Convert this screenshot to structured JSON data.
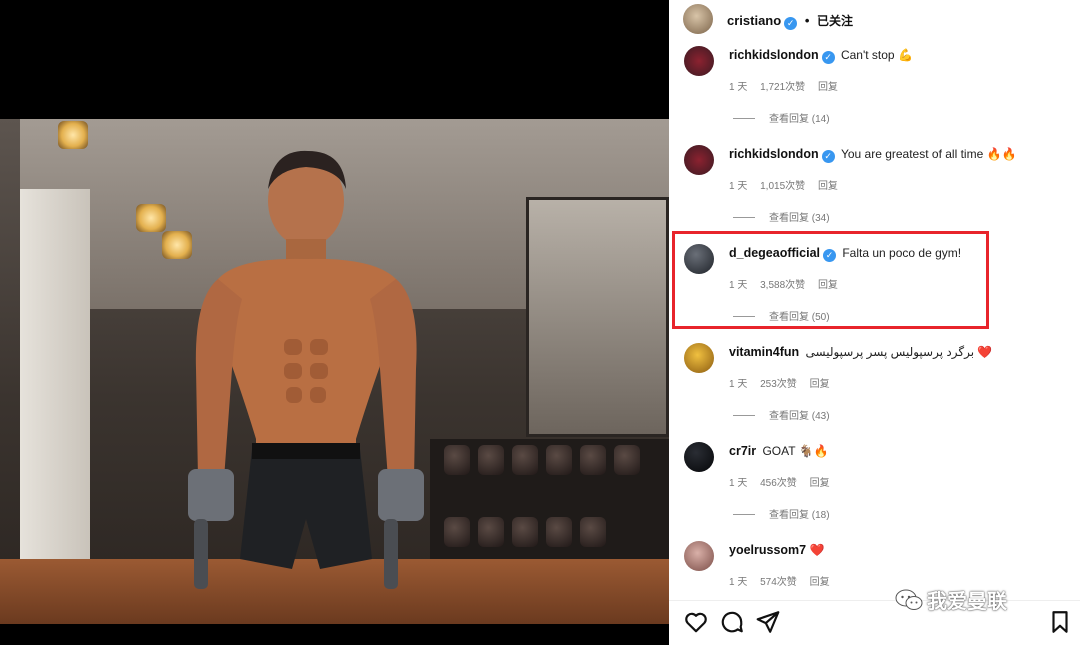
{
  "header": {
    "username": "cristiano",
    "separator": "•",
    "follow_label": "已关注"
  },
  "comments": [
    {
      "user": "richkidslondon",
      "verified": true,
      "text": "Can't stop",
      "emoji": "💪",
      "time": "1 天",
      "likes": "1,721次赞",
      "reply": "回复",
      "view_replies": "查看回复 (14)"
    },
    {
      "user": "richkidslondon",
      "verified": true,
      "text": "You are greatest of all time",
      "emoji": "🔥🔥",
      "time": "1 天",
      "likes": "1,015次赞",
      "reply": "回复",
      "view_replies": "查看回复 (34)"
    },
    {
      "user": "d_degeaofficial",
      "verified": true,
      "text": "Falta un poco de gym!",
      "emoji": "",
      "time": "1 天",
      "likes": "3,588次赞",
      "reply": "回复",
      "view_replies": "查看回复 (50)"
    },
    {
      "user": "vitamin4fun",
      "verified": false,
      "text": "برگرد پرسپولیس پسر پرسپولیسی",
      "emoji": "❤️",
      "time": "1 天",
      "likes": "253次赞",
      "reply": "回复",
      "view_replies": "查看回复 (43)"
    },
    {
      "user": "cr7ir",
      "verified": false,
      "text": "GOAT",
      "emoji": "🐐🔥",
      "time": "1 天",
      "likes": "456次赞",
      "reply": "回复",
      "view_replies": "查看回复 (18)"
    },
    {
      "user": "yoelrussom7",
      "verified": false,
      "text": "",
      "emoji": "❤️",
      "time": "1 天",
      "likes": "574次赞",
      "reply": "回复",
      "view_replies": ""
    }
  ],
  "watermark": "我爱曼联",
  "icons": {
    "like": "heart-icon",
    "comment": "comment-icon",
    "share": "send-icon",
    "save": "bookmark-icon"
  },
  "colors": {
    "verified": "#3897f0",
    "highlight": "#e8242b"
  }
}
